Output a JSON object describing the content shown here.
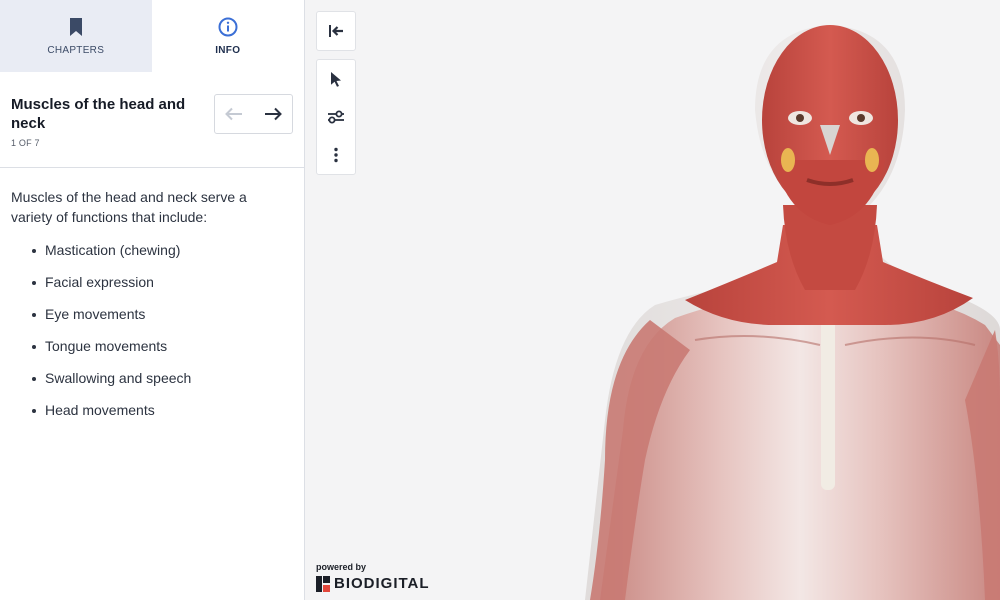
{
  "tabs": {
    "chapters": {
      "label": "CHAPTERS",
      "icon": "bookmark-icon"
    },
    "info": {
      "label": "INFO",
      "icon": "info-icon"
    }
  },
  "chapter": {
    "title": "Muscles of the head and neck",
    "counter": "1 OF 7"
  },
  "content": {
    "intro": "Muscles of the head and neck serve a variety of functions that include:",
    "bullets": [
      "Mastication (chewing)",
      "Facial expression",
      "Eye movements",
      "Tongue movements",
      "Swallowing and speech",
      "Head movements"
    ]
  },
  "toolbar": {
    "collapse_icon": "collapse-left-icon",
    "select_icon": "pointer-icon",
    "settings_icon": "sliders-icon",
    "more_icon": "more-vertical-icon"
  },
  "branding": {
    "powered_by": "powered by",
    "name": "BIODIGITAL"
  },
  "colors": {
    "accent": "#3b6fd6",
    "tab_active_bg": "#e9ecf4",
    "muscle": "#c94a42"
  }
}
